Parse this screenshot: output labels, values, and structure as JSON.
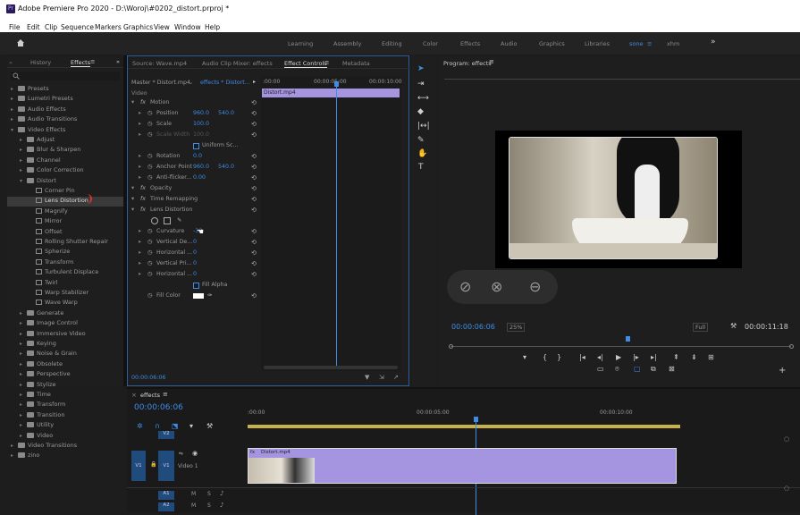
{
  "window": {
    "title": "Adobe Premiere Pro 2020 - D:\\Woroj\\#0202_distort.prproj *",
    "app_icon": "Pr"
  },
  "menu": [
    "File",
    "Edit",
    "Clip",
    "Sequence",
    "Markers",
    "Graphics",
    "View",
    "Window",
    "Help"
  ],
  "workspaces": [
    "Learning",
    "Assembly",
    "Editing",
    "Color",
    "Effects",
    "Audio",
    "Graphics",
    "Libraries",
    "sone",
    "xhm"
  ],
  "left_panel": {
    "tabs": [
      "History",
      "Effects"
    ],
    "tree": [
      {
        "label": "Presets",
        "type": "folder",
        "level": 0
      },
      {
        "label": "Lumetri Presets",
        "type": "folder",
        "level": 0
      },
      {
        "label": "Audio Effects",
        "type": "folder",
        "level": 0
      },
      {
        "label": "Audio Transitions",
        "type": "folder",
        "level": 0
      },
      {
        "label": "Video Effects",
        "type": "folder",
        "level": 0,
        "open": true
      },
      {
        "label": "Adjust",
        "type": "folder",
        "level": 1
      },
      {
        "label": "Blur & Sharpen",
        "type": "folder",
        "level": 1
      },
      {
        "label": "Channel",
        "type": "folder",
        "level": 1
      },
      {
        "label": "Color Correction",
        "type": "folder",
        "level": 1
      },
      {
        "label": "Distort",
        "type": "folder",
        "level": 1,
        "open": true
      },
      {
        "label": "Corner Pin",
        "type": "fx",
        "level": 2
      },
      {
        "label": "Lens Distortion",
        "type": "fx",
        "level": 2,
        "selected": true
      },
      {
        "label": "Magnify",
        "type": "fx",
        "level": 2
      },
      {
        "label": "Mirror",
        "type": "fx",
        "level": 2
      },
      {
        "label": "Offset",
        "type": "fx",
        "level": 2
      },
      {
        "label": "Rolling Shutter Repair",
        "type": "fx",
        "level": 2
      },
      {
        "label": "Spherize",
        "type": "fx",
        "level": 2
      },
      {
        "label": "Transform",
        "type": "fx",
        "level": 2
      },
      {
        "label": "Turbulent Displace",
        "type": "fx",
        "level": 2
      },
      {
        "label": "Twirl",
        "type": "fx",
        "level": 2
      },
      {
        "label": "Warp Stabilizer",
        "type": "fx",
        "level": 2
      },
      {
        "label": "Wave Warp",
        "type": "fx",
        "level": 2
      },
      {
        "label": "Generate",
        "type": "folder",
        "level": 1
      },
      {
        "label": "Image Control",
        "type": "folder",
        "level": 1
      },
      {
        "label": "Immersive Video",
        "type": "folder",
        "level": 1
      },
      {
        "label": "Keying",
        "type": "folder",
        "level": 1
      },
      {
        "label": "Noise & Grain",
        "type": "folder",
        "level": 1
      },
      {
        "label": "Obsolete",
        "type": "folder",
        "level": 1
      },
      {
        "label": "Perspective",
        "type": "folder",
        "level": 1
      },
      {
        "label": "Stylize",
        "type": "folder",
        "level": 1
      },
      {
        "label": "Time",
        "type": "folder",
        "level": 1
      },
      {
        "label": "Transform",
        "type": "folder",
        "level": 1
      },
      {
        "label": "Transition",
        "type": "folder",
        "level": 1
      },
      {
        "label": "Utility",
        "type": "folder",
        "level": 1
      },
      {
        "label": "Video",
        "type": "folder",
        "level": 1
      },
      {
        "label": "Video Transitions",
        "type": "folder",
        "level": 0
      },
      {
        "label": "zino",
        "type": "folder",
        "level": 0
      }
    ]
  },
  "effect_controls": {
    "tabs": [
      "Source: Wave.mp4",
      "Audio Clip Mixer: effects",
      "Effect Controls",
      "Metadata"
    ],
    "master": "Master * Distort.mp4",
    "clip": "effects * Distort...",
    "section": "Video",
    "ruler": [
      ":00:00",
      "00:00:05:00",
      "00:00:10:00"
    ],
    "clip_bar": "Distort.mp4",
    "rows": [
      {
        "label": "Motion",
        "kind": "fx"
      },
      {
        "label": "Position",
        "v1": "960.0",
        "v2": "540.0"
      },
      {
        "label": "Scale",
        "v1": "100.0"
      },
      {
        "label": "Scale Width",
        "v1": "100.0",
        "dim": true
      },
      {
        "label": "Uniform Sc...",
        "kind": "check"
      },
      {
        "label": "Rotation",
        "v1": "0.0"
      },
      {
        "label": "Anchor Point",
        "v1": "960.0",
        "v2": "540.0"
      },
      {
        "label": "Anti-flicker...",
        "v1": "0.00"
      },
      {
        "label": "Opacity",
        "kind": "fx"
      },
      {
        "label": "Time Remapping",
        "kind": "fx"
      },
      {
        "label": "Lens Distortion",
        "kind": "fx"
      },
      {
        "label": "",
        "kind": "shapes"
      },
      {
        "label": "Curvature",
        "v1": "-30"
      },
      {
        "label": "Vertical De...",
        "v1": "0"
      },
      {
        "label": "Horizontal ...",
        "v1": "0"
      },
      {
        "label": "Vertical Pri...",
        "v1": "0"
      },
      {
        "label": "Horizontal ...",
        "v1": "0"
      },
      {
        "label": "Fill Alpha",
        "kind": "check"
      },
      {
        "label": "Fill Color",
        "kind": "color"
      }
    ],
    "timecode": "00:00:06:06"
  },
  "program": {
    "title": "Program: effects",
    "timecode": "00:00:06:06",
    "zoom": "25%",
    "quality": "Full",
    "duration": "00:00:11:18",
    "playhead_fraction": 0.52
  },
  "timeline": {
    "tab": "effects",
    "timecode": "00:00:06:06",
    "ruler": [
      ":00:00",
      "00:00:05:00",
      "00:00:10:00"
    ],
    "tracks": {
      "v2": "V2",
      "v1": "V1",
      "a1": "A1",
      "a2": "A2",
      "video_label": "Video 1"
    },
    "clip": "Distort.mp4"
  },
  "colors": {
    "accent": "#3f8ce6",
    "clip": "#a594e0",
    "work_area": "#c8b04a"
  }
}
